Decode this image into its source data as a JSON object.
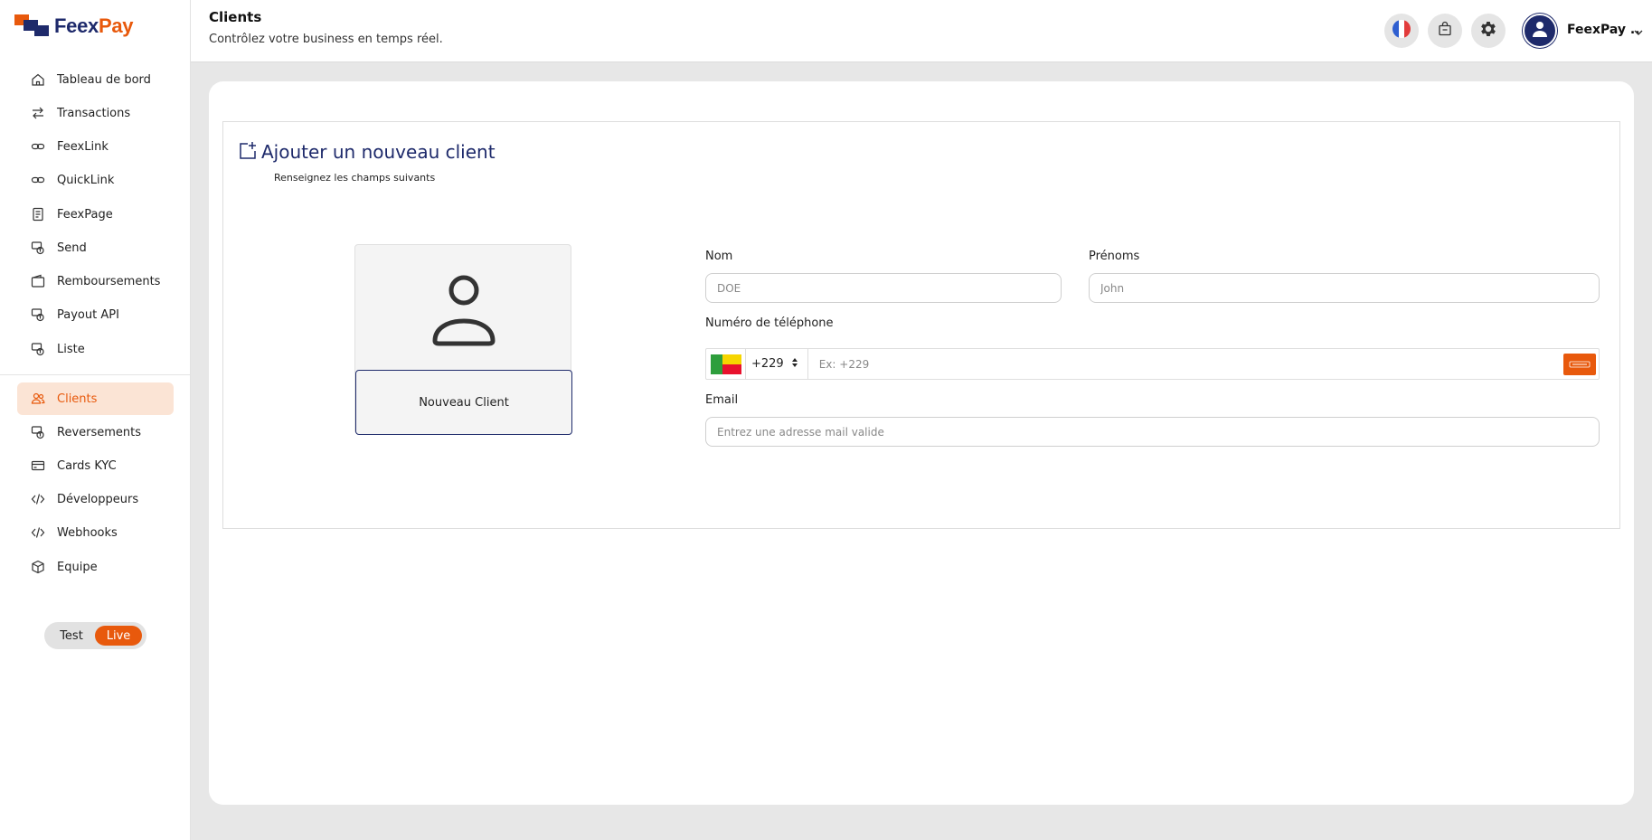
{
  "brand": {
    "name_part1": "Feex",
    "name_part2": "Pay",
    "accent": "#e8590c",
    "primary": "#1e2a6b"
  },
  "sidebar": {
    "items": [
      {
        "label": "Tableau de bord",
        "icon": "home-icon"
      },
      {
        "label": "Transactions",
        "icon": "transfer-icon"
      },
      {
        "label": "FeexLink",
        "icon": "link-icon"
      },
      {
        "label": "QuickLink",
        "icon": "link-icon"
      },
      {
        "label": "FeexPage",
        "icon": "page-icon"
      },
      {
        "label": "Send",
        "icon": "money-send-icon"
      },
      {
        "label": "Remboursements",
        "icon": "wallet-icon"
      },
      {
        "label": "Payout API",
        "icon": "money-send-icon"
      },
      {
        "label": "Liste",
        "icon": "money-send-icon"
      },
      {
        "label": "Clients",
        "icon": "users-icon",
        "active": true
      },
      {
        "label": "Reversements",
        "icon": "money-send-icon"
      },
      {
        "label": "Cards KYC",
        "icon": "card-icon"
      },
      {
        "label": "Développeurs",
        "icon": "code-icon"
      },
      {
        "label": "Webhooks",
        "icon": "code-icon"
      },
      {
        "label": "Equipe",
        "icon": "box-icon"
      }
    ],
    "mode_toggle": {
      "test_label": "Test",
      "live_label": "Live",
      "selected": "Live"
    }
  },
  "header": {
    "title": "Clients",
    "subtitle": "Contrôlez votre business en temps réel.",
    "user_name": "FeexPay ..",
    "icons": [
      "france-flag-icon",
      "shopping-bag-icon",
      "gear-icon",
      "user-avatar-icon",
      "chevron-down-icon"
    ]
  },
  "form": {
    "title": "Ajouter un nouveau client",
    "subtitle": "Renseignez les champs suivants",
    "photo_button_label": "Nouveau Client",
    "nom": {
      "label": "Nom",
      "placeholder": "DOE"
    },
    "prenoms": {
      "label": "Prénoms",
      "placeholder": "John"
    },
    "phone": {
      "label": "Numéro de téléphone",
      "dial_code": "+229",
      "placeholder": "Ex: +229",
      "country_flag": "benin-flag-icon"
    },
    "email": {
      "label": "Email",
      "placeholder": "Entrez une adresse mail valide"
    }
  }
}
